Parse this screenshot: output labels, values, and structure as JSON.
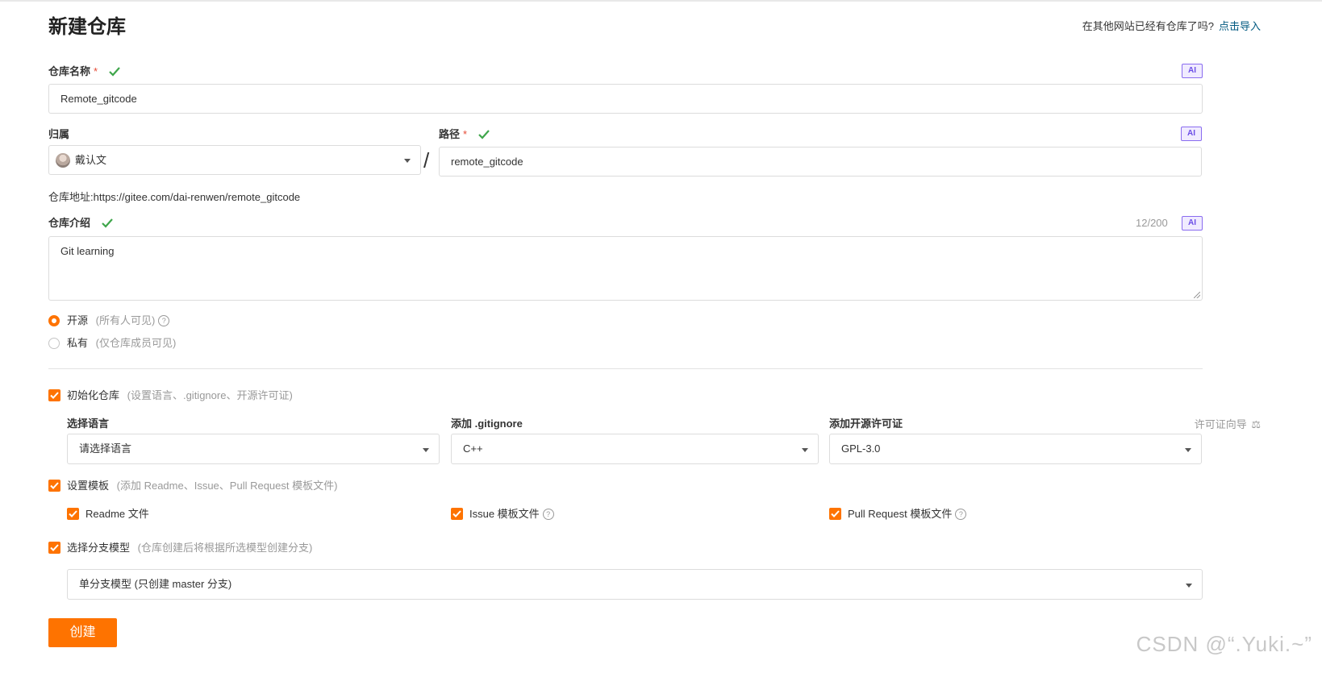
{
  "header": {
    "title": "新建仓库",
    "import_prompt": "在其他网站已经有仓库了吗?",
    "import_link": "点击导入"
  },
  "repo_name": {
    "label": "仓库名称",
    "required_mark": "*",
    "value": "Remote_gitcode",
    "ai_badge": "AI"
  },
  "owner": {
    "label": "归属",
    "value": "戴认文"
  },
  "path": {
    "separator": "/",
    "label": "路径",
    "required_mark": "*",
    "value": "remote_gitcode",
    "ai_badge": "AI"
  },
  "repo_address": {
    "label": "仓库地址:",
    "url": "https://gitee.com/dai-renwen/remote_gitcode"
  },
  "description": {
    "label": "仓库介绍",
    "counter": "12/200",
    "ai_badge": "AI",
    "value": "Git learning"
  },
  "visibility": {
    "selected": "open",
    "options": [
      {
        "label": "开源",
        "hint": "(所有人可见)"
      },
      {
        "label": "私有",
        "hint": "(仅仓库成员可见)"
      }
    ]
  },
  "init_repo": {
    "checked": true,
    "label": "初始化仓库",
    "hint": "(设置语言、.gitignore、开源许可证)",
    "language": {
      "label": "选择语言",
      "value": "请选择语言"
    },
    "gitignore": {
      "label": "添加 .gitignore",
      "value": "C++"
    },
    "license": {
      "label": "添加开源许可证",
      "value": "GPL-3.0",
      "wizard": "许可证向导"
    }
  },
  "templates": {
    "checked": true,
    "label": "设置模板",
    "hint": "(添加 Readme、Issue、Pull Request 模板文件)",
    "items": [
      {
        "label": "Readme 文件",
        "checked": true
      },
      {
        "label": "Issue 模板文件",
        "checked": true
      },
      {
        "label": "Pull Request 模板文件",
        "checked": true
      }
    ]
  },
  "branch_model": {
    "checked": true,
    "label": "选择分支模型",
    "hint": "(仓库创建后将根据所选模型创建分支)",
    "value": "单分支模型 (只创建 master 分支)"
  },
  "create_button": "创建",
  "watermark": "CSDN @“.Yuki.~”",
  "colors": {
    "accent": "#fe7300",
    "success": "#3fa64b",
    "link": "#005980",
    "ai_badge": "#6b4ee6"
  }
}
